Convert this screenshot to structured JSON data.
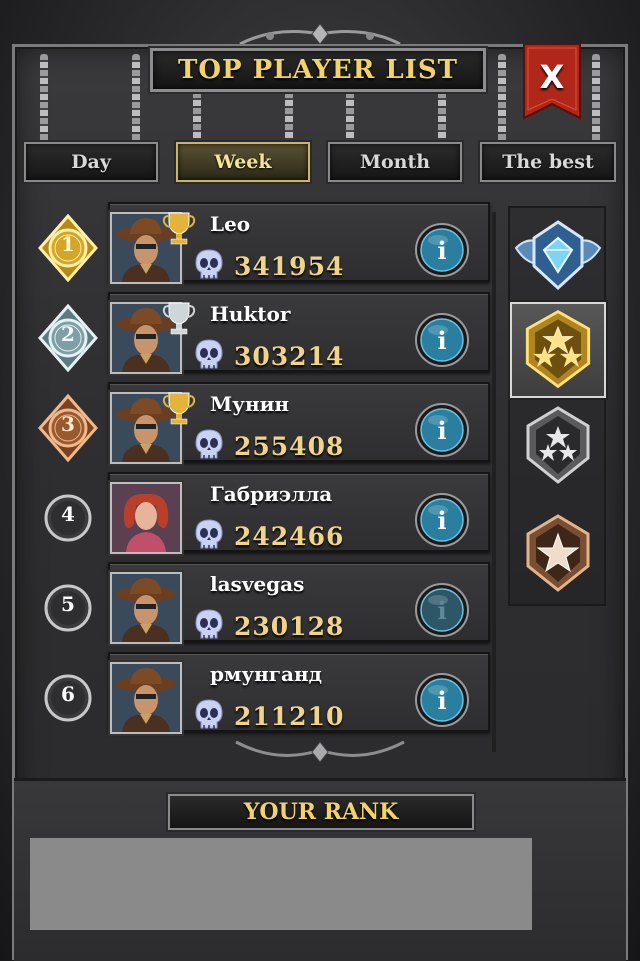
{
  "header": {
    "title": "TOP PLAYER LIST",
    "close_label": "X"
  },
  "tabs": [
    {
      "label": "Day",
      "active": false
    },
    {
      "label": "Week",
      "active": true
    },
    {
      "label": "Month",
      "active": false
    },
    {
      "label": "The best",
      "active": false
    }
  ],
  "players": [
    {
      "rank": "1",
      "name": "Leo",
      "score": "341954",
      "medal": "gold",
      "trophy": "gold",
      "info_active": true
    },
    {
      "rank": "2",
      "name": "Huktor",
      "score": "303214",
      "medal": "silver",
      "trophy": "silver",
      "info_active": true
    },
    {
      "rank": "3",
      "name": "Мунин",
      "score": "255408",
      "medal": "bronze",
      "trophy": "gold",
      "info_active": true
    },
    {
      "rank": "4",
      "name": "Габриэлла",
      "score": "242466",
      "medal": "plain",
      "trophy": "",
      "info_active": true
    },
    {
      "rank": "5",
      "name": "lasvegas",
      "score": "230128",
      "medal": "plain",
      "trophy": "",
      "info_active": false
    },
    {
      "rank": "6",
      "name": "рмунганд",
      "score": "211210",
      "medal": "plain",
      "trophy": "",
      "info_active": true
    }
  ],
  "league_badges": [
    {
      "name": "diamond-league",
      "selected": false
    },
    {
      "name": "gold-league",
      "selected": true
    },
    {
      "name": "silver-league",
      "selected": false
    },
    {
      "name": "bronze-league",
      "selected": false
    }
  ],
  "your_rank": {
    "label": "YOUR RANK"
  },
  "colors": {
    "title_gold": "#f2d26a",
    "score_gold": "#f0d488",
    "close_red": "#b0271a",
    "info_blue": "#2a7fa0"
  },
  "icons": {
    "score": "skull-icon",
    "info": "info-icon",
    "trophy": "trophy-icon"
  }
}
